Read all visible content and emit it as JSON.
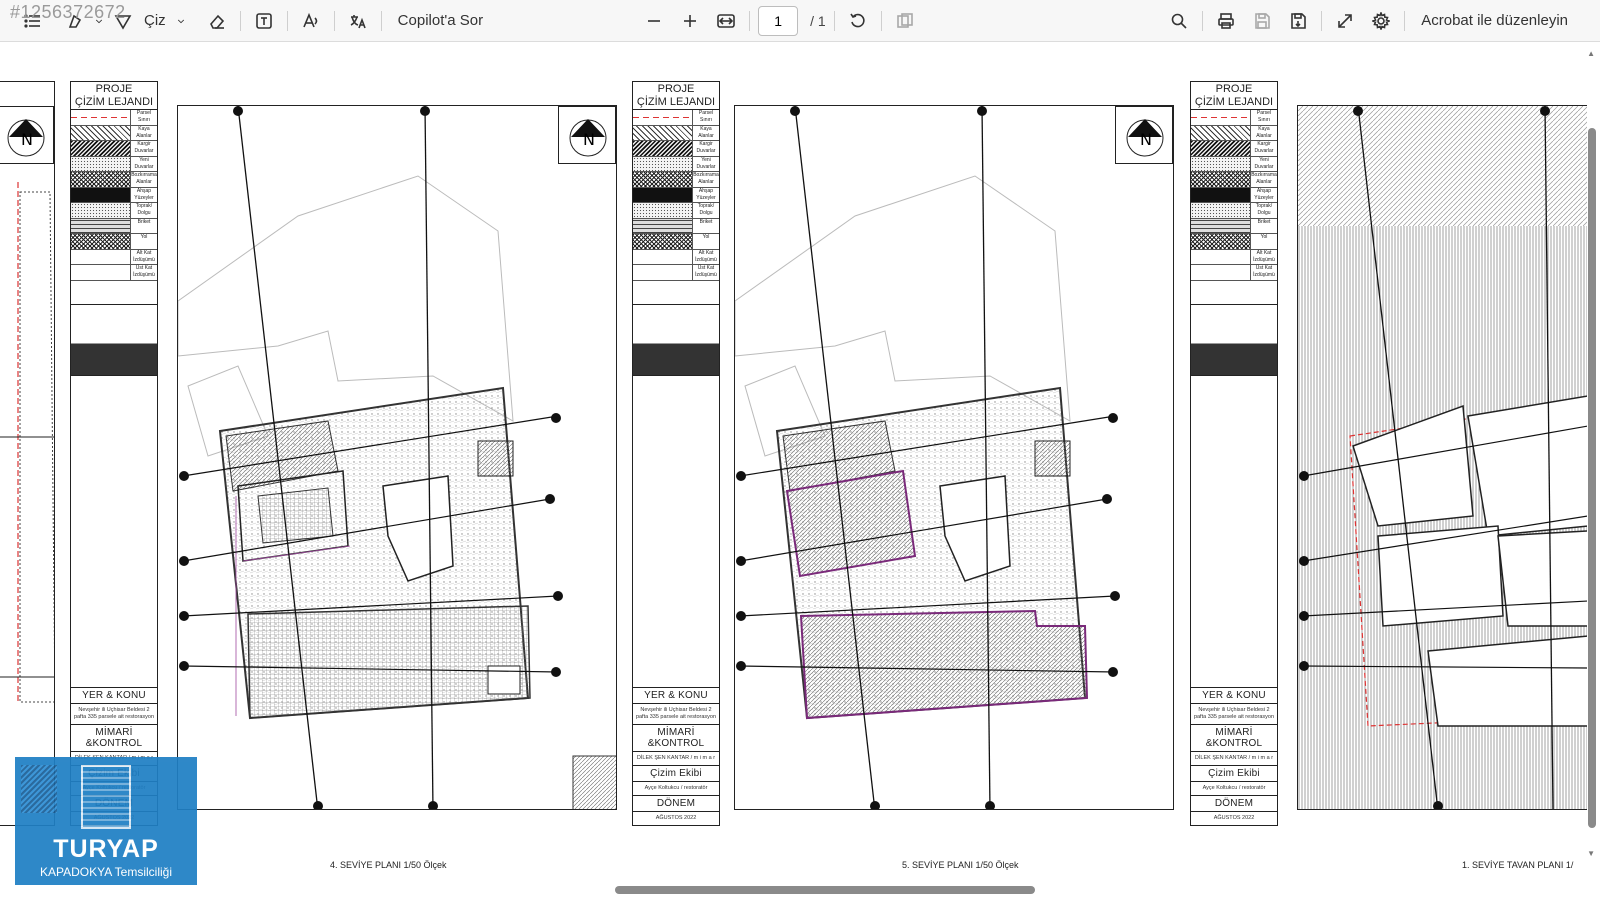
{
  "watermark": {
    "listing_id": "#1256372672"
  },
  "toolbar": {
    "draw_label": "Çiz",
    "copilot_label": "Copilot'a Sor",
    "page_current": "1",
    "page_total": "/ 1",
    "edit_label": "Acrobat ile düzenleyin"
  },
  "legend": {
    "title_line1": "PROJE",
    "title_line2": "ÇİZİM LEJANDI",
    "rows": [
      "Parsel Sınırı",
      "Kaya Alanlar",
      "Kargir Duvarlar",
      "Yeni Duvarlar",
      "Bozkırrama Alanlar",
      "Ahşap Yüzeyler",
      "Toprak/ Dolgu",
      "Briket",
      "Yol",
      "Alt Kat İzdüşümü",
      "Üst Kat İzdüşümü"
    ],
    "place_head": "YER & KONU",
    "place_text": "Nevşehir ili Uçhisar Beldesi 2 pafta 335 parsele ait restorasyon",
    "architect_head": "MİMARİ &KONTROL",
    "architect_text": "DİLEK ŞEN KANTAR / m i m a r",
    "team_head": "Çizim Ekibi",
    "team_text": "Ayçe Koltukcu / restoratör",
    "period_head": "DÖNEM",
    "period_text": "AĞUSTOS 2022"
  },
  "plans": {
    "plan_4_caption": "4. SEVİYE PLANI 1/50  Ölçek",
    "plan_5_caption": "5. SEVİYE PLANI 1/50  Ölçek",
    "plan_1_caption": "1. SEVİYE TAVAN PLANI 1/"
  },
  "logo": {
    "brand": "TURYAP",
    "office": "KAPADOKYA Temsilciliği"
  },
  "colors": {
    "toolbar_bg": "#f7f7f7",
    "logo_blue": "#1f7fc4",
    "parcel_red": "#d33333"
  }
}
